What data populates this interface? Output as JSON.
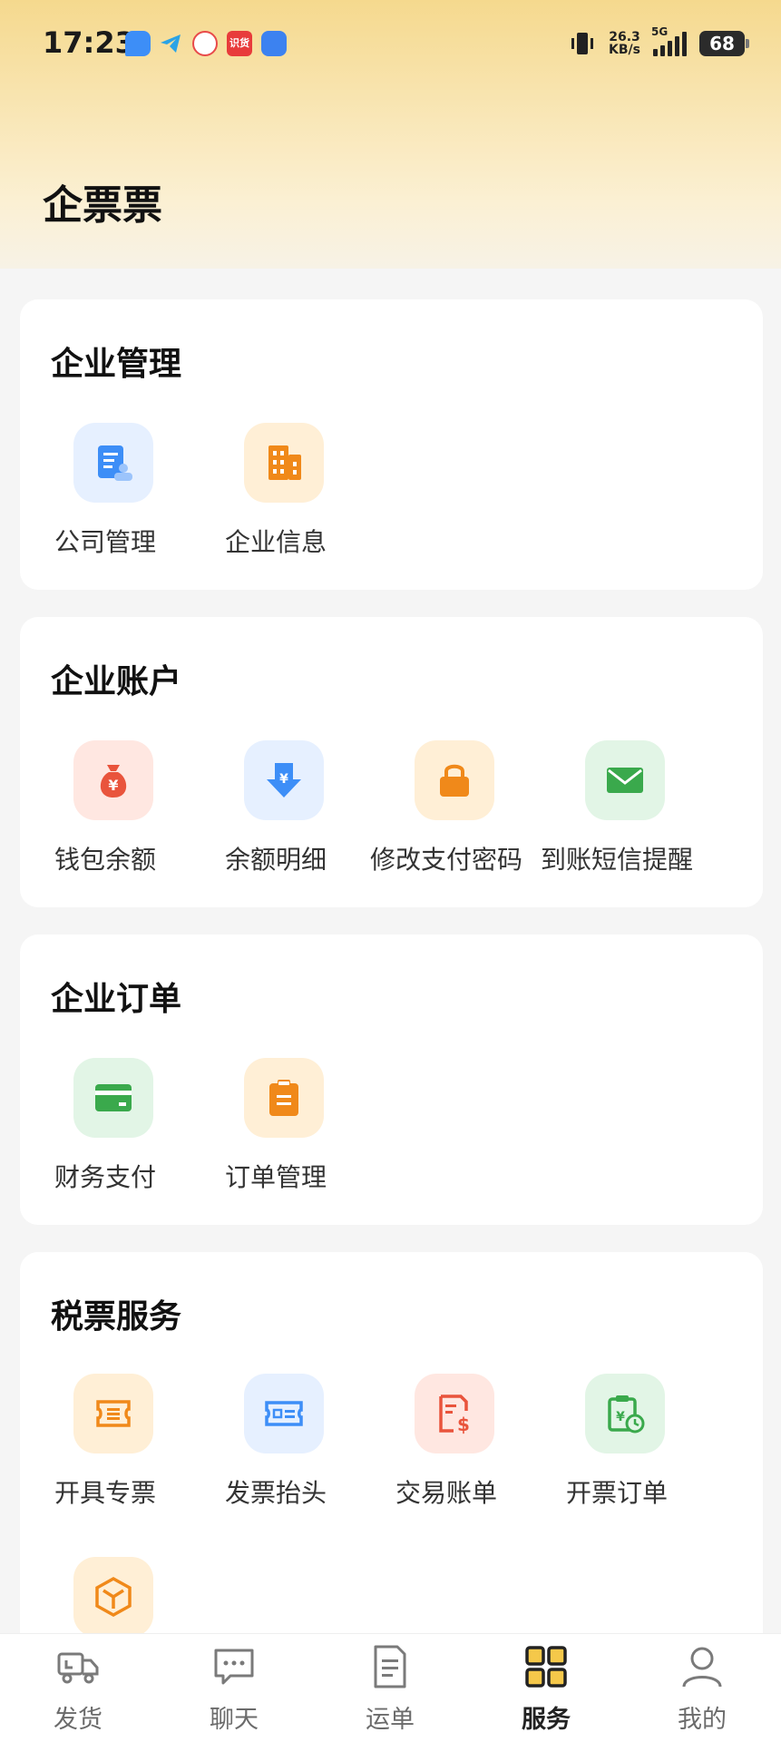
{
  "status_bar": {
    "time": "17:23",
    "net_speed_value": "26.3",
    "net_speed_unit": "KB/s",
    "network_type": "5G",
    "battery": "68",
    "notif_badge_text": "识货"
  },
  "app": {
    "title": "企票票"
  },
  "sections": [
    {
      "title": "企业管理",
      "items": [
        {
          "label": "公司管理",
          "icon": "company-doc-icon"
        },
        {
          "label": "企业信息",
          "icon": "building-icon"
        }
      ]
    },
    {
      "title": "企业账户",
      "items": [
        {
          "label": "钱包余额",
          "icon": "money-bag-icon"
        },
        {
          "label": "余额明细",
          "icon": "download-yuan-icon"
        },
        {
          "label": "修改支付密码",
          "icon": "lock-icon"
        },
        {
          "label": "到账短信提醒",
          "icon": "mail-icon"
        }
      ]
    },
    {
      "title": "企业订单",
      "items": [
        {
          "label": "财务支付",
          "icon": "card-icon"
        },
        {
          "label": "订单管理",
          "icon": "clipboard-icon"
        }
      ]
    },
    {
      "title": "税票服务",
      "items": [
        {
          "label": "开具专票",
          "icon": "ticket-icon"
        },
        {
          "label": "发票抬头",
          "icon": "invoice-header-icon"
        },
        {
          "label": "交易账单",
          "icon": "bill-dollar-icon"
        },
        {
          "label": "开票订单",
          "icon": "clipboard-clock-icon"
        },
        {
          "label": "",
          "icon": "box-icon"
        }
      ]
    }
  ],
  "bottom_nav": [
    {
      "label": "发货",
      "icon": "truck-icon"
    },
    {
      "label": "聊天",
      "icon": "chat-icon"
    },
    {
      "label": "运单",
      "icon": "document-icon"
    },
    {
      "label": "服务",
      "icon": "grid-icon",
      "active": true
    },
    {
      "label": "我的",
      "icon": "person-icon"
    }
  ],
  "colors": {
    "accent_orange": "#f0891a",
    "icon_blue": "#3d8ef7",
    "icon_red": "#e9543c",
    "icon_green": "#3aa94c",
    "nav_active": "#222222",
    "header_gradient_top": "#f5d98e"
  }
}
